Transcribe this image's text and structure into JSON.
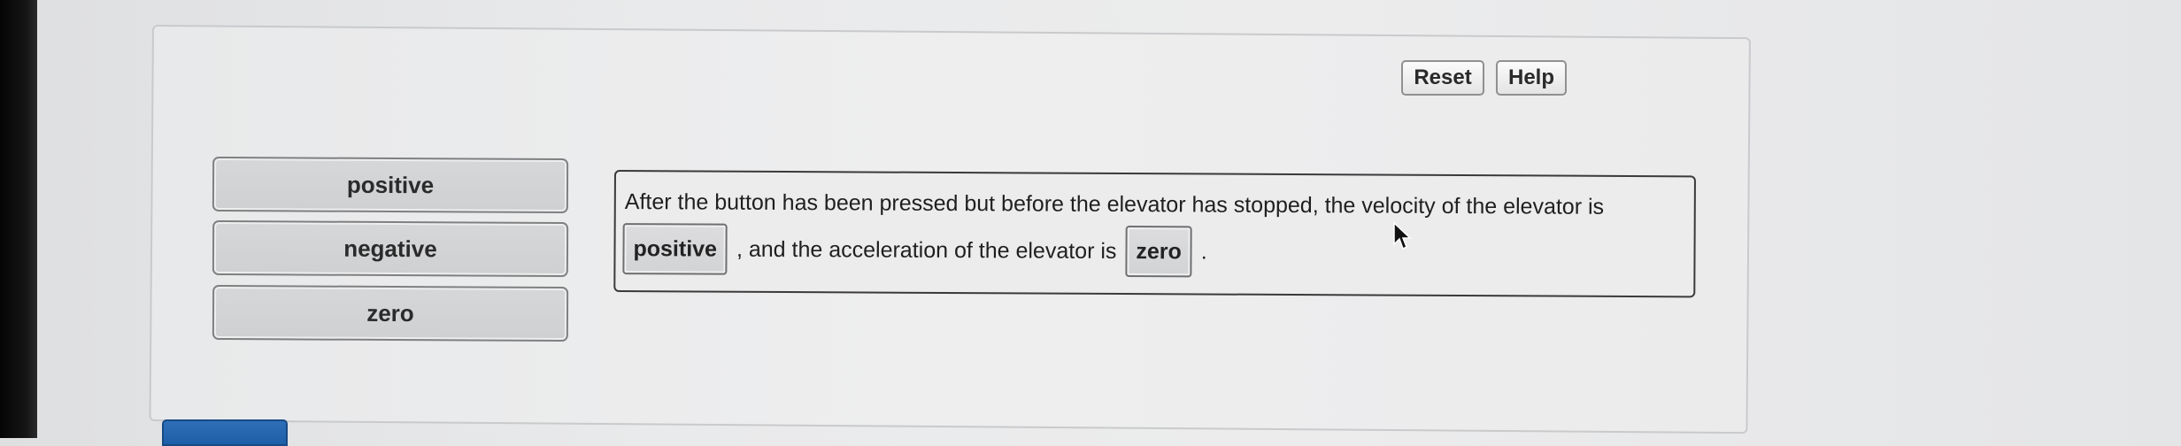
{
  "toolbar": {
    "reset_label": "Reset",
    "help_label": "Help"
  },
  "choices": [
    {
      "label": "positive"
    },
    {
      "label": "negative"
    },
    {
      "label": "zero"
    }
  ],
  "sentence": {
    "line1": "After the button has been pressed but before the elevator has stopped, the velocity of the elevator is",
    "blank1_value": "positive",
    "middle_text": ", and the acceleration of the elevator is",
    "blank2_value": "zero",
    "end_text": "."
  },
  "colors": {
    "submit_blue": "#1d5ea8",
    "panel_border": "#c9cacc"
  }
}
